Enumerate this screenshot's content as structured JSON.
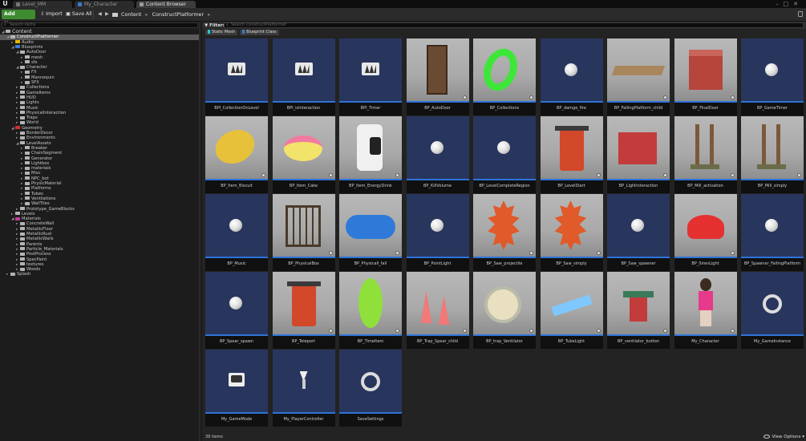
{
  "tabs": [
    {
      "label": "Level_MM",
      "active": false
    },
    {
      "label": "My_Character",
      "active": false
    },
    {
      "label": "Content Browser",
      "active": true
    }
  ],
  "toolbar": {
    "add_new": "Add New",
    "import": "Import",
    "save_all": "Save All",
    "breadcrumb": [
      "Content",
      "ConstructPlatformer"
    ]
  },
  "sources": {
    "search_placeholder": "Search Paths",
    "tree": [
      {
        "label": "Content",
        "depth": 0,
        "expanded": true
      },
      {
        "label": "ConstructPlatformer",
        "depth": 1,
        "expanded": true,
        "selected": true
      },
      {
        "label": "Audio",
        "depth": 2,
        "color": "#e6b800"
      },
      {
        "label": "Blueprints",
        "depth": 2,
        "expanded": true,
        "color": "#3a7bd5"
      },
      {
        "label": "AutoDoor",
        "depth": 3,
        "expanded": true
      },
      {
        "label": "mesh",
        "depth": 4
      },
      {
        "label": "sfx",
        "depth": 4
      },
      {
        "label": "Character",
        "depth": 3,
        "expanded": true
      },
      {
        "label": "FX",
        "depth": 4
      },
      {
        "label": "Mannequin",
        "depth": 4
      },
      {
        "label": "SFX",
        "depth": 4
      },
      {
        "label": "Collections",
        "depth": 3
      },
      {
        "label": "GameItems",
        "depth": 3
      },
      {
        "label": "HUD",
        "depth": 3
      },
      {
        "label": "Lights",
        "depth": 3
      },
      {
        "label": "Music",
        "depth": 3
      },
      {
        "label": "PhysicalInteraction",
        "depth": 3
      },
      {
        "label": "Traps",
        "depth": 3
      },
      {
        "label": "World",
        "depth": 3
      },
      {
        "label": "Geometry",
        "depth": 2,
        "expanded": true,
        "color": "#d32f2f"
      },
      {
        "label": "BorderDecor",
        "depth": 3
      },
      {
        "label": "Environments",
        "depth": 3
      },
      {
        "label": "LevelAssets",
        "depth": 3,
        "expanded": true
      },
      {
        "label": "Breaker",
        "depth": 4
      },
      {
        "label": "ChainSegment",
        "depth": 4
      },
      {
        "label": "Generator",
        "depth": 4
      },
      {
        "label": "Lightbox",
        "depth": 4
      },
      {
        "label": "materials",
        "depth": 4
      },
      {
        "label": "Misc",
        "depth": 4
      },
      {
        "label": "NPC_bot",
        "depth": 4
      },
      {
        "label": "PhysicMaterial",
        "depth": 4
      },
      {
        "label": "Platforms",
        "depth": 4
      },
      {
        "label": "Tubes",
        "depth": 4
      },
      {
        "label": "Ventilations",
        "depth": 4
      },
      {
        "label": "WallTiles",
        "depth": 4
      },
      {
        "label": "Prototype_GameBlocks",
        "depth": 3
      },
      {
        "label": "Levels",
        "depth": 2
      },
      {
        "label": "Materials",
        "depth": 2,
        "expanded": true,
        "color": "#c0399f"
      },
      {
        "label": "ConcreteWall",
        "depth": 3
      },
      {
        "label": "MetallicFloor",
        "depth": 3
      },
      {
        "label": "MetallicRust",
        "depth": 3
      },
      {
        "label": "MetallicWalls",
        "depth": 3
      },
      {
        "label": "Parents",
        "depth": 3
      },
      {
        "label": "Particle_Materials",
        "depth": 3
      },
      {
        "label": "PostProcess",
        "depth": 3
      },
      {
        "label": "SpecPaint",
        "depth": 3
      },
      {
        "label": "textures",
        "depth": 3
      },
      {
        "label": "Woods",
        "depth": 3
      },
      {
        "label": "Splash",
        "depth": 1
      }
    ]
  },
  "assets": {
    "filters_label": "Filters",
    "search_placeholder": "Search ConstructPlatformer",
    "filter_chips": [
      {
        "label": "Static Mesh",
        "color": "#1ec8d8"
      },
      {
        "label": "Blueprint Class",
        "color": "#3a7bd5"
      }
    ],
    "items": [
      {
        "name": "BPI_CollectionOnLevel",
        "thumb": "bp-interface-icon"
      },
      {
        "name": "BPI_isInteraction",
        "thumb": "bp-interface-icon"
      },
      {
        "name": "BPI_Timer",
        "thumb": "bp-interface-icon"
      },
      {
        "name": "BP_AutoDoor",
        "thumb": "door-render"
      },
      {
        "name": "BP_Collections",
        "thumb": "green-ring-render"
      },
      {
        "name": "BP_damge_fire",
        "thumb": "sphere-icon"
      },
      {
        "name": "BP_FallingPlatform_child",
        "thumb": "wood-plank-render"
      },
      {
        "name": "BP_FinalDoor",
        "thumb": "final-door-render"
      },
      {
        "name": "BP_GameTimer",
        "thumb": "sphere-icon"
      },
      {
        "name": "BP_Item_Biscuit",
        "thumb": "biscuit-render"
      },
      {
        "name": "BP_Item_Cake",
        "thumb": "cake-render"
      },
      {
        "name": "BP_Item_EnergyDrink",
        "thumb": "energy-drink-render"
      },
      {
        "name": "BP_KillVolume",
        "thumb": "sphere-icon"
      },
      {
        "name": "BP_LevelCompleteRegion",
        "thumb": "sphere-icon"
      },
      {
        "name": "BP_LevelStart",
        "thumb": "red-pad-render"
      },
      {
        "name": "BP_LightInteraction",
        "thumb": "light-box-render"
      },
      {
        "name": "BP_Mill_activation",
        "thumb": "mill-render"
      },
      {
        "name": "BP_Mill_simply",
        "thumb": "mill-render"
      },
      {
        "name": "BP_Music",
        "thumb": "sphere-icon"
      },
      {
        "name": "BP_PhysicalBox",
        "thumb": "cage-render"
      },
      {
        "name": "BP_Physicall_fall",
        "thumb": "blue-barrel-render"
      },
      {
        "name": "BP_PointLight",
        "thumb": "sphere-icon"
      },
      {
        "name": "BP_Saw_projectile",
        "thumb": "saw-render"
      },
      {
        "name": "BP_Saw_simply",
        "thumb": "saw-render"
      },
      {
        "name": "BP_Saw_spawner",
        "thumb": "sphere-icon"
      },
      {
        "name": "BP_SirenLight",
        "thumb": "siren-render"
      },
      {
        "name": "BP_Spawner_FallingPlatform",
        "thumb": "sphere-icon"
      },
      {
        "name": "BP_Spear_spawn",
        "thumb": "sphere-icon"
      },
      {
        "name": "BP_Teleport",
        "thumb": "red-pad-render"
      },
      {
        "name": "BP_TimeItem",
        "thumb": "stopwatch-render"
      },
      {
        "name": "BP_Trap_Spear_child",
        "thumb": "spear-render"
      },
      {
        "name": "BP_trap_Ventilator",
        "thumb": "ventilator-render"
      },
      {
        "name": "BP_TubeLight",
        "thumb": "tube-light-render"
      },
      {
        "name": "BP_ventilator_button",
        "thumb": "button-render"
      },
      {
        "name": "My_Character",
        "thumb": "character-render"
      },
      {
        "name": "My_GameInstance",
        "thumb": "ring-icon"
      },
      {
        "name": "My_GameMode",
        "thumb": "gamemode-icon"
      },
      {
        "name": "My_PlayerController",
        "thumb": "controller-icon"
      },
      {
        "name": "SaveSettings",
        "thumb": "ring-icon"
      }
    ],
    "items_count": "39 items",
    "view_options": "View Options"
  },
  "colors": {
    "accent_blue": "#2e73d8",
    "add_new_green": "#3e8c2f",
    "tile_bg": "#28365e"
  }
}
